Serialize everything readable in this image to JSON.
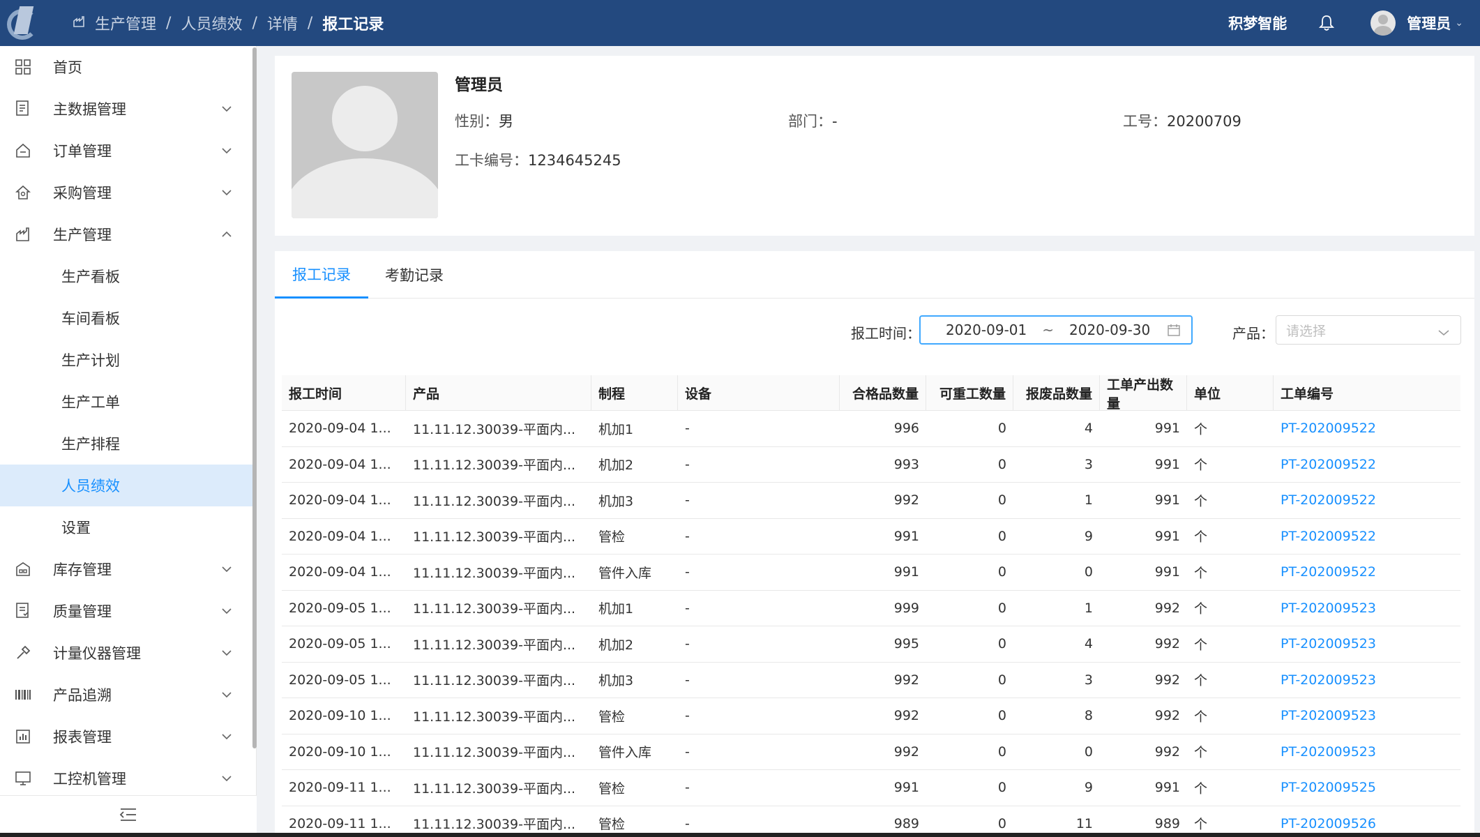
{
  "header": {
    "breadcrumb": [
      "生产管理",
      "人员绩效",
      "详情",
      "报工记录"
    ],
    "company": "积梦智能",
    "user": "管理员"
  },
  "sidebar": {
    "items": [
      {
        "label": "首页",
        "icon": "grid-icon"
      },
      {
        "label": "主数据管理",
        "icon": "database-icon",
        "chevron": "down"
      },
      {
        "label": "订单管理",
        "icon": "order-icon",
        "chevron": "down"
      },
      {
        "label": "采购管理",
        "icon": "purchase-icon",
        "chevron": "down"
      },
      {
        "label": "生产管理",
        "icon": "factory-icon",
        "chevron": "up"
      }
    ],
    "sub_items": [
      "生产看板",
      "车间看板",
      "生产计划",
      "生产工单",
      "生产排程",
      "人员绩效",
      "设置"
    ],
    "active_sub": "人员绩效",
    "items_after": [
      {
        "label": "库存管理",
        "icon": "warehouse-icon"
      },
      {
        "label": "质量管理",
        "icon": "quality-icon"
      },
      {
        "label": "计量仪器管理",
        "icon": "wrench-icon"
      },
      {
        "label": "产品追溯",
        "icon": "barcode-icon"
      },
      {
        "label": "报表管理",
        "icon": "report-icon"
      },
      {
        "label": "工控机管理",
        "icon": "monitor-icon"
      }
    ]
  },
  "profile": {
    "name": "管理员",
    "gender_label": "性别：",
    "gender": "男",
    "dept_label": "部门：",
    "dept": "-",
    "emp_no_label": "工号：",
    "emp_no": "20200709",
    "card_label": "工卡编号：",
    "card_no": "1234645245"
  },
  "tabs": [
    "报工记录",
    "考勤记录"
  ],
  "filters": {
    "time_label": "报工时间：",
    "date_from": "2020-09-01",
    "date_sep": "~",
    "date_to": "2020-09-30",
    "product_label": "产品：",
    "product_placeholder": "请选择"
  },
  "table": {
    "columns": [
      "报工时间",
      "产品",
      "制程",
      "设备",
      "合格品数量",
      "可重工数量",
      "报废品数量",
      "工单产出数量",
      "单位",
      "工单编号"
    ],
    "rows": [
      [
        "2020-09-04 1...",
        "11.11.12.30039-平面内...",
        "机加1",
        "-",
        "996",
        "0",
        "4",
        "991",
        "个",
        "PT-202009522"
      ],
      [
        "2020-09-04 1...",
        "11.11.12.30039-平面内...",
        "机加2",
        "-",
        "993",
        "0",
        "3",
        "991",
        "个",
        "PT-202009522"
      ],
      [
        "2020-09-04 1...",
        "11.11.12.30039-平面内...",
        "机加3",
        "-",
        "992",
        "0",
        "1",
        "991",
        "个",
        "PT-202009522"
      ],
      [
        "2020-09-04 1...",
        "11.11.12.30039-平面内...",
        "管检",
        "-",
        "991",
        "0",
        "9",
        "991",
        "个",
        "PT-202009522"
      ],
      [
        "2020-09-04 1...",
        "11.11.12.30039-平面内...",
        "管件入库",
        "-",
        "991",
        "0",
        "0",
        "991",
        "个",
        "PT-202009522"
      ],
      [
        "2020-09-05 1...",
        "11.11.12.30039-平面内...",
        "机加1",
        "-",
        "999",
        "0",
        "1",
        "992",
        "个",
        "PT-202009523"
      ],
      [
        "2020-09-05 1...",
        "11.11.12.30039-平面内...",
        "机加2",
        "-",
        "995",
        "0",
        "4",
        "992",
        "个",
        "PT-202009523"
      ],
      [
        "2020-09-05 1...",
        "11.11.12.30039-平面内...",
        "机加3",
        "-",
        "992",
        "0",
        "3",
        "992",
        "个",
        "PT-202009523"
      ],
      [
        "2020-09-10 1...",
        "11.11.12.30039-平面内...",
        "管检",
        "-",
        "992",
        "0",
        "8",
        "992",
        "个",
        "PT-202009523"
      ],
      [
        "2020-09-10 1...",
        "11.11.12.30039-平面内...",
        "管件入库",
        "-",
        "992",
        "0",
        "0",
        "992",
        "个",
        "PT-202009523"
      ],
      [
        "2020-09-11 1...",
        "11.11.12.30039-平面内...",
        "管检",
        "-",
        "991",
        "0",
        "9",
        "991",
        "个",
        "PT-202009525"
      ],
      [
        "2020-09-11 1...",
        "11.11.12.30039-平面内...",
        "管检",
        "-",
        "989",
        "0",
        "11",
        "989",
        "个",
        "PT-202009526"
      ]
    ]
  },
  "colors": {
    "header_bg": "#23497f",
    "accent": "#1890ff",
    "active_menu_bg": "#dcebfb"
  }
}
